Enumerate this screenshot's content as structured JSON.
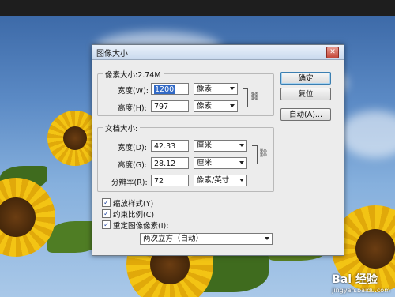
{
  "dialog": {
    "title": "图像大小",
    "close_label": "✕"
  },
  "pixel_dimensions": {
    "group_label": "像素大小:2.74M",
    "width_label": "宽度(W):",
    "width_value": "1200",
    "width_unit": "像素",
    "height_label": "高度(H):",
    "height_value": "797",
    "height_unit": "像素"
  },
  "document_size": {
    "group_label": "文档大小:",
    "width_label": "宽度(D):",
    "width_value": "42.33",
    "width_unit": "厘米",
    "height_label": "高度(G):",
    "height_value": "28.12",
    "height_unit": "厘米",
    "resolution_label": "分辨率(R):",
    "resolution_value": "72",
    "resolution_unit": "像素/英寸"
  },
  "buttons": {
    "ok": "确定",
    "reset": "复位",
    "auto": "自动(A)..."
  },
  "options": {
    "scale_styles": {
      "label": "缩放样式(Y)",
      "checked": true
    },
    "constrain_proportions": {
      "label": "约束比例(C)",
      "checked": true
    },
    "resample": {
      "label": "重定图像像素(I):",
      "checked": true
    },
    "resample_method": "两次立方（自动）"
  },
  "watermark": {
    "title": "Bai 经验",
    "url": "jingyan.baidu.com"
  }
}
